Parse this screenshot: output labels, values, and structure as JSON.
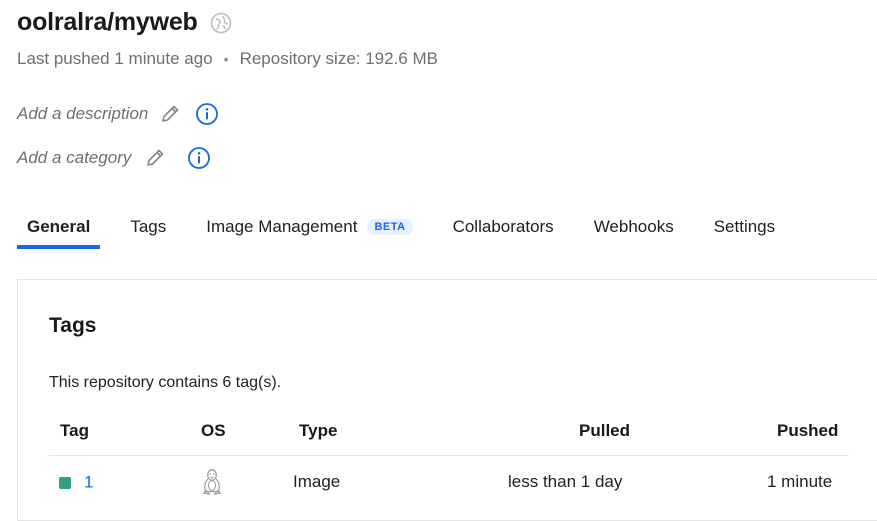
{
  "repo": {
    "title": "oolralra/myweb",
    "last_pushed": "Last pushed 1 minute ago",
    "separator": "•",
    "size": "Repository size: 192.6 MB",
    "description_placeholder": "Add a description",
    "category_placeholder": "Add a category"
  },
  "tabs": [
    {
      "label": "General",
      "active": true
    },
    {
      "label": "Tags"
    },
    {
      "label": "Image Management",
      "badge": "BETA"
    },
    {
      "label": "Collaborators"
    },
    {
      "label": "Webhooks"
    },
    {
      "label": "Settings"
    }
  ],
  "tags_panel": {
    "title": "Tags",
    "summary": "This repository contains 6 tag(s).",
    "columns": [
      "Tag",
      "OS",
      "Type",
      "Pulled",
      "Pushed"
    ],
    "rows": [
      {
        "tag": "1",
        "os": "linux-icon",
        "type": "Image",
        "pulled": "less than 1 day",
        "pushed": "1 minute"
      }
    ]
  },
  "colors": {
    "accent": "#1769e0",
    "tag_swatch": "#2f9e82",
    "muted_text": "#6b6f76"
  },
  "icons": [
    "public-globe-icon",
    "pencil-icon",
    "info-icon",
    "linux-icon"
  ]
}
